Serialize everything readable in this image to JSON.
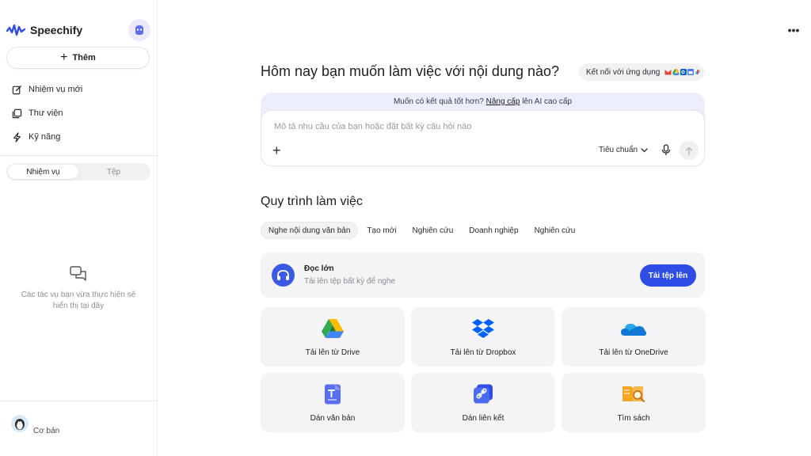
{
  "app": {
    "name": "Speechify"
  },
  "sidebar": {
    "add_label": "Thêm",
    "nav": [
      {
        "label": "Nhiệm vụ mới",
        "icon": "edit-icon"
      },
      {
        "label": "Thư viện",
        "icon": "library-icon"
      },
      {
        "label": "Kỹ năng",
        "icon": "bolt-icon"
      }
    ],
    "segments": [
      {
        "label": "Nhiệm vụ",
        "active": true
      },
      {
        "label": "Tệp",
        "active": false
      }
    ],
    "empty_text": "Các tác vụ bạn vừa thực hiện sẽ hiển thị tại đây",
    "user_label": "Cơ bản"
  },
  "main": {
    "title": "Hôm nay bạn muốn làm việc với nội dung nào?",
    "connect_label": "Kết nối với ứng dụng",
    "upsell": {
      "prefix": "Muốn có kết quả tốt hơn?",
      "link": "Nâng cấp",
      "suffix": "lên AI cao cấp"
    },
    "prompt": {
      "placeholder": "Mô tả nhu cầu của bạn hoặc đặt bất kỳ câu hỏi nào",
      "value": "",
      "mode_label": "Tiêu chuẩn"
    },
    "workflow_title": "Quy trình làm việc",
    "tabs": [
      {
        "label": "Nghe nội dung văn bản",
        "active": true
      },
      {
        "label": "Tạo mới",
        "active": false
      },
      {
        "label": "Nghiên cứu",
        "active": false
      },
      {
        "label": "Doanh nghiệp",
        "active": false
      },
      {
        "label": "Nghiên cứu",
        "active": false
      }
    ],
    "read_card": {
      "title": "Đọc lớn",
      "subtitle": "Tải lên tệp bất kỳ để nghe",
      "button": "Tải tệp lên"
    },
    "tiles": [
      {
        "label": "Tải lên từ Drive",
        "icon": "google-drive-icon"
      },
      {
        "label": "Tải lên từ Dropbox",
        "icon": "dropbox-icon"
      },
      {
        "label": "Tải lên từ OneDrive",
        "icon": "onedrive-icon"
      },
      {
        "label": "Dán văn bản",
        "icon": "text-document-icon"
      },
      {
        "label": "Dán liên kết",
        "icon": "link-icon"
      },
      {
        "label": "Tìm sách",
        "icon": "book-search-icon"
      }
    ]
  },
  "colors": {
    "accent": "#2f4de6",
    "brand": "#3a5ae6",
    "prompt_bg": "#eceefc"
  }
}
